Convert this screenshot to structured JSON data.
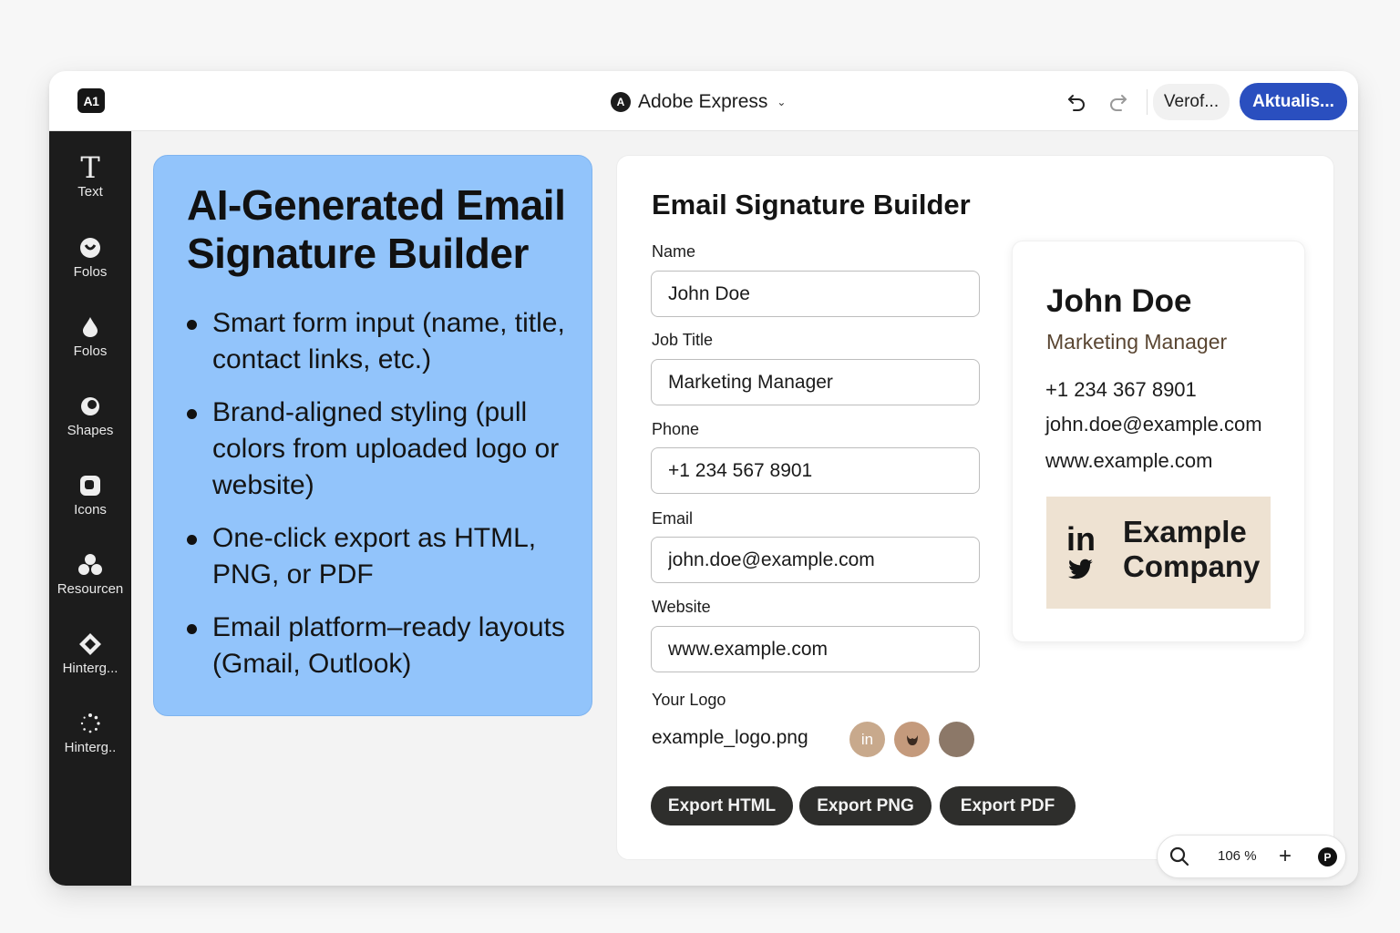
{
  "app": {
    "logo_text": "A1",
    "title": "Adobe Express",
    "title_icon": "adobe-express-icon",
    "verify_label": "Verof...",
    "update_label": "Aktualis..."
  },
  "sidebar": {
    "items": [
      {
        "label": "Text",
        "icon": "text-icon"
      },
      {
        "label": "Folos",
        "icon": "photo-icon"
      },
      {
        "label": "Folos",
        "icon": "droplet-icon"
      },
      {
        "label": "Shapes",
        "icon": "shapes-icon"
      },
      {
        "label": "Icons",
        "icon": "icons-icon"
      },
      {
        "label": "Resourcen",
        "icon": "resources-icon"
      },
      {
        "label": "Hinterg...",
        "icon": "background-icon"
      },
      {
        "label": "Hinterg..",
        "icon": "loading-icon"
      }
    ]
  },
  "promo": {
    "title": "AI-Generated Email Signature Builder",
    "bullets": [
      "Smart form input (name, title, contact links, etc.)",
      "Brand-aligned styling (pull colors from uploaded logo or website)",
      "One-click export as HTML, PNG, or PDF",
      "Email platform–ready layouts (Gmail, Outlook)"
    ]
  },
  "form": {
    "title": "Email Signature Builder",
    "fields": [
      {
        "label": "Name",
        "value": "John Doe"
      },
      {
        "label": "Job Title",
        "value": "Marketing Manager"
      },
      {
        "label": "Phone",
        "value": "+1 234 567 8901"
      },
      {
        "label": "Email",
        "value": "john.doe@example.com"
      },
      {
        "label": "Website",
        "value": "www.example.com"
      }
    ],
    "logo_label": "Your Logo",
    "logo_file": "example_logo.png",
    "swatches": [
      {
        "color": "#c8a98c",
        "icon": "linkedin-icon",
        "text": "in"
      },
      {
        "color": "#c49a7c",
        "icon": "brand-mark-icon",
        "text": ""
      },
      {
        "color": "#8c7868",
        "icon": "",
        "text": ""
      }
    ],
    "export_buttons": [
      "Export HTML",
      "Export PNG",
      "Export PDF"
    ]
  },
  "preview": {
    "name": "John Doe",
    "title": "Marketing Manager",
    "phone": "+1 234 367 8901",
    "email": "john.doe@example.com",
    "website": "www.example.com",
    "social_in": "in",
    "social_icons": [
      "linkedin-icon",
      "twitter-icon"
    ],
    "company": "Example Company",
    "company_bg": "#eee2d2"
  },
  "zoom": {
    "value": "106 %",
    "badge": "P"
  },
  "colors": {
    "accent": "#2a4fbf",
    "promo_bg": "#92c4fb",
    "sidebar_bg": "#1c1c1c",
    "export_btn": "#2e2e2c"
  }
}
